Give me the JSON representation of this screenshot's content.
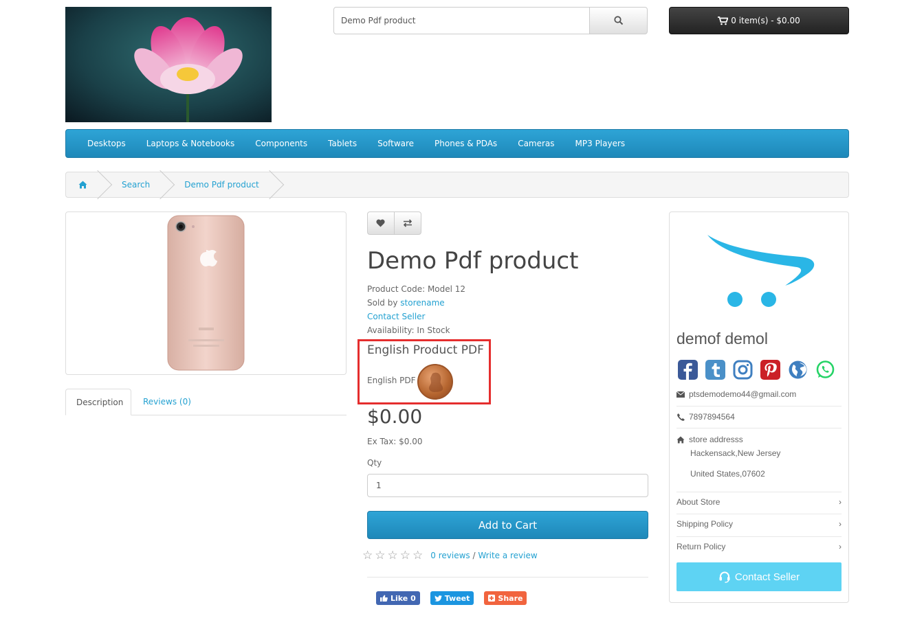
{
  "search": {
    "value": "Demo Pdf product"
  },
  "cart": {
    "label": "0 item(s) - $0.00"
  },
  "menu": [
    "Desktops",
    "Laptops & Notebooks",
    "Components",
    "Tablets",
    "Software",
    "Phones & PDAs",
    "Cameras",
    "MP3 Players"
  ],
  "breadcrumb": {
    "home_icon": "home-icon",
    "items": [
      "Search",
      "Demo Pdf product"
    ]
  },
  "tabs": {
    "description": "Description",
    "reviews": "Reviews (0)"
  },
  "product": {
    "title": "Demo Pdf product",
    "code_label": "Product Code: Model 12",
    "sold_by_label": "Sold by",
    "seller_link": "storename",
    "contact_seller_link": "Contact Seller",
    "availability": "Availability: In Stock",
    "pdf_heading": "English Product PDF",
    "pdf_label": "English PDF :",
    "price": "$0.00",
    "ex_tax": "Ex Tax: $0.00",
    "qty_label": "Qty",
    "qty_value": "1",
    "add_to_cart": "Add to Cart",
    "rating": 0,
    "reviews_link": "0 reviews",
    "separator": "/",
    "write_review": "Write a review"
  },
  "share": {
    "like": "Like 0",
    "tweet": "Tweet",
    "share": "Share"
  },
  "seller": {
    "name": "demof demol",
    "email": "ptsdemodemo44@gmail.com",
    "phone": "7897894564",
    "address_line1": "store addresss",
    "address_line2": "Hackensack,New Jersey",
    "address_line3": "United States,07602",
    "about": "About Store",
    "shipping": "Shipping Policy",
    "return": "Return Policy",
    "contact_button": "Contact Seller",
    "social_icons": [
      "facebook-icon",
      "tumblr-icon",
      "instagram-icon",
      "pinterest-icon",
      "globe-icon",
      "whatsapp-icon"
    ]
  },
  "colors": {
    "primary": "#229ac8",
    "link": "#23a1d1",
    "highlight_border": "#e52d2d",
    "contact_button": "#5ed3f3"
  }
}
